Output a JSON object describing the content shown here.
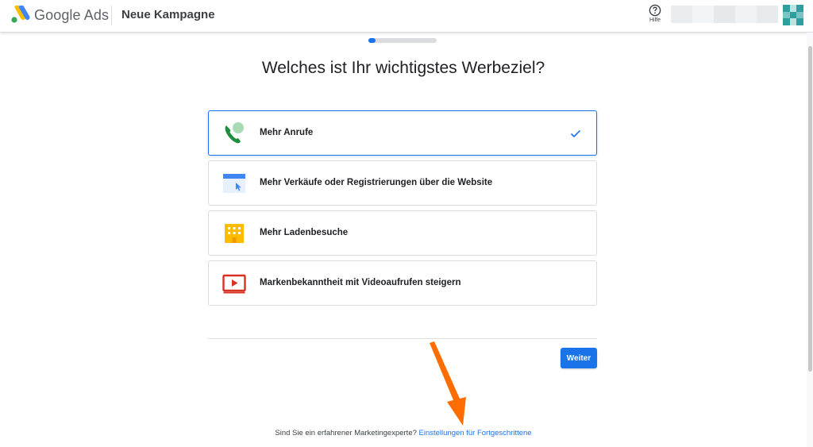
{
  "header": {
    "brand": "Google Ads",
    "campaign_title": "Neue Kampagne",
    "help_label": "Hilfe"
  },
  "progress": {
    "value": 0.1
  },
  "page_title": "Welches ist Ihr wichtigstes Werbeziel?",
  "options": [
    {
      "label": "Mehr Anrufe",
      "icon": "phone-icon",
      "selected": true
    },
    {
      "label": "Mehr Verkäufe oder Registrierungen über die Website",
      "icon": "website-icon",
      "selected": false
    },
    {
      "label": "Mehr Ladenbesuche",
      "icon": "store-icon",
      "selected": false
    },
    {
      "label": "Markenbekanntheit mit Videoaufrufen steigern",
      "icon": "video-icon",
      "selected": false
    }
  ],
  "next_label": "Weiter",
  "footer": {
    "text": "Sind Sie ein erfahrener Marketingexperte?",
    "link": "Einstellungen für Fortgeschrittene"
  },
  "colors": {
    "accent": "#1a73e8",
    "annotation_arrow": "#ff6d00"
  }
}
